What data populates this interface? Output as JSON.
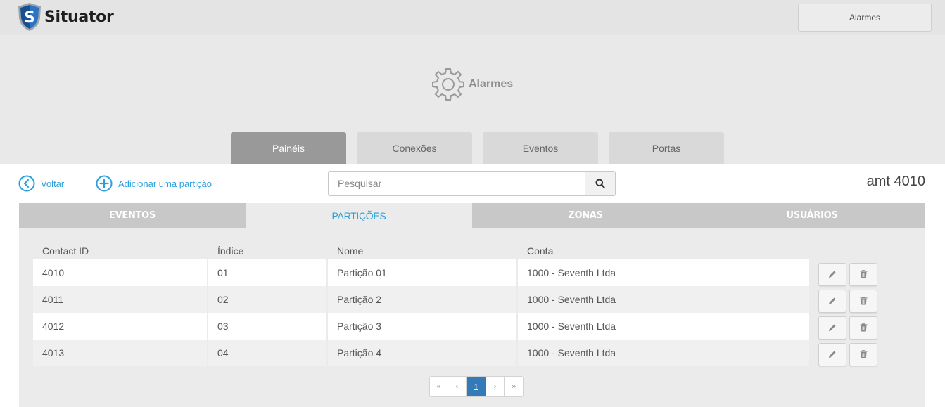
{
  "app": {
    "name": "Situator",
    "top_button": "Alarmes"
  },
  "header": {
    "title": "Alarmes"
  },
  "main_tabs": [
    {
      "label": "Painéis",
      "active": true
    },
    {
      "label": "Conexões",
      "active": false
    },
    {
      "label": "Eventos",
      "active": false
    },
    {
      "label": "Portas",
      "active": false
    }
  ],
  "toolbar": {
    "back_label": "Voltar",
    "add_label": "Adicionar uma partição",
    "search_placeholder": "Pesquisar",
    "device_name": "amt 4010"
  },
  "sub_tabs": [
    {
      "label": "EVENTOS",
      "active": false
    },
    {
      "label": "PARTIÇÕES",
      "active": true
    },
    {
      "label": "ZONAS",
      "active": false
    },
    {
      "label": "USUÁRIOS",
      "active": false
    }
  ],
  "table": {
    "columns": [
      "Contact ID",
      "Índice",
      "Nome",
      "Conta"
    ],
    "rows": [
      [
        "4010",
        "01",
        "Partição 01",
        "1000 - Seventh Ltda"
      ],
      [
        "4011",
        "02",
        "Partição 2",
        "1000 - Seventh Ltda"
      ],
      [
        "4012",
        "03",
        "Partição 3",
        "1000 - Seventh Ltda"
      ],
      [
        "4013",
        "04",
        "Partição 4",
        "1000 - Seventh Ltda"
      ]
    ]
  },
  "pagination": {
    "first": "«",
    "prev": "‹",
    "current": "1",
    "next": "›",
    "last": "»"
  },
  "colors": {
    "accent": "#2a9fdc",
    "active_tab": "#999999",
    "page_active": "#337ab7"
  }
}
